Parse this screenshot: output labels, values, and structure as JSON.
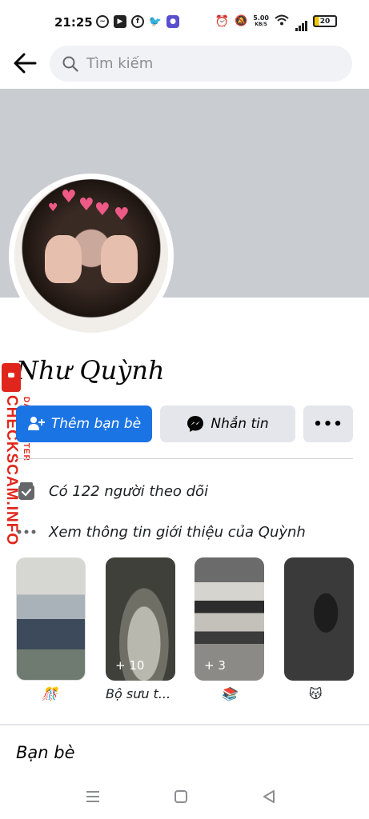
{
  "status_bar": {
    "time": "21:25",
    "speed_value": "5.00",
    "speed_unit": "KB/S",
    "battery": "20",
    "left_icons": [
      "messenger-icon",
      "play-icon",
      "facebook-icon",
      "twitter-icon",
      "app-icon"
    ],
    "right_icons": [
      "alarm-icon",
      "mute-icon",
      "wifi-icon",
      "signal-icon",
      "battery-icon"
    ]
  },
  "header": {
    "search_placeholder": "Tìm kiếm"
  },
  "profile": {
    "name": "Như Quỳnh"
  },
  "actions": {
    "add_friend": "Thêm bạn bè",
    "message": "Nhắn tin",
    "more": "•••"
  },
  "info": {
    "followers": "Có 122 người theo dõi",
    "about": "Xem thông tin giới thiệu của Quỳnh"
  },
  "featured": [
    {
      "label": "🎊",
      "count": ""
    },
    {
      "label": "Bộ sưu t...",
      "count": "+ 10"
    },
    {
      "label": "📚",
      "count": "+ 3"
    },
    {
      "label": "😽",
      "count": ""
    }
  ],
  "friends": {
    "title": "Bạn bè"
  },
  "watermark": {
    "main": "CHECKSCAM.INFO",
    "sub": "DATA CENTER"
  },
  "colors": {
    "primary": "#1b74e4",
    "secondary_button": "#e4e6eb",
    "cover": "#c9ccd1",
    "watermark": "#e0261c"
  }
}
